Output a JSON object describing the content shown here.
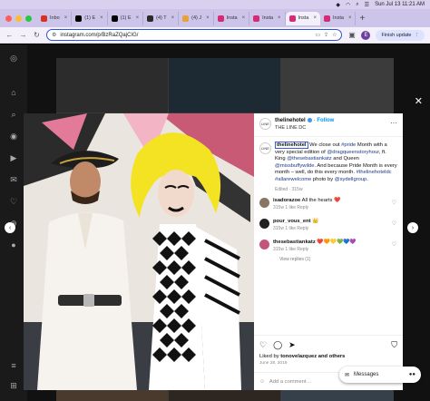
{
  "menubar": {
    "datetime": "Sun Jul 13 11:21 AM"
  },
  "tabs": [
    {
      "label": "Inbo",
      "color": "#d93025"
    },
    {
      "label": "(1) E",
      "color": "#000000"
    },
    {
      "label": "(1) E",
      "color": "#000000"
    },
    {
      "label": "(4) T",
      "color": "#2b2b2b"
    },
    {
      "label": "(4) J",
      "color": "#e9a23b"
    },
    {
      "label": "Insta",
      "color": "#d62976"
    },
    {
      "label": "Insta",
      "color": "#d62976"
    },
    {
      "label": "Insta",
      "color": "#d62976",
      "active": true
    },
    {
      "label": "Insta",
      "color": "#d62976"
    }
  ],
  "address": {
    "url": "instagram.com/p/BzRaZQajCIG/",
    "profile_initial": "E",
    "finish_update": "Finish update"
  },
  "post": {
    "username": "thelinehotel",
    "follow": "Follow",
    "location": "THE LINE DC",
    "caption_prefix": "We close out ",
    "caption_tag1": "#pride",
    "caption_mid1": " Month with a very special edition of ",
    "caption_handle1": "@dragqueenstoryhour",
    "caption_mid2": ", ft. King ",
    "caption_handle2": "@thesebastiankatz",
    "caption_mid3": " and Queen ",
    "caption_handle3": "@missbuffywilde",
    "caption_mid4": ". And because Pride Month is every month – well, do this every month. ",
    "caption_tags": "#thelinehoteldc #allarewelcome",
    "caption_mid5": " photo by ",
    "caption_handle4": "@sydellgroup",
    "caption_end": ".",
    "edited": "Edited · 315w",
    "liked_by_prefix": "Liked by ",
    "liked_by_user": "tonovelazquez",
    "liked_by_suffix": " and others",
    "date": "June 28, 2019",
    "add_comment_placeholder": "Add a comment…",
    "post_label": "Post"
  },
  "comments": [
    {
      "user": "isadorazoe",
      "text": "All the hearts ❤️",
      "meta": "315w   1 like   Reply",
      "avatar": "#8a7560"
    },
    {
      "user": "pour_vous_ent",
      "text": "👑",
      "meta": "315w   1 like   Reply",
      "avatar": "#222222"
    },
    {
      "user": "thesebastiankatz",
      "text": "❤️🧡💛💚💙💜",
      "meta": "315w   1 like   Reply",
      "avatar": "#c4547a"
    }
  ],
  "view_replies": "View replies (1)",
  "messages_label": "Messages"
}
